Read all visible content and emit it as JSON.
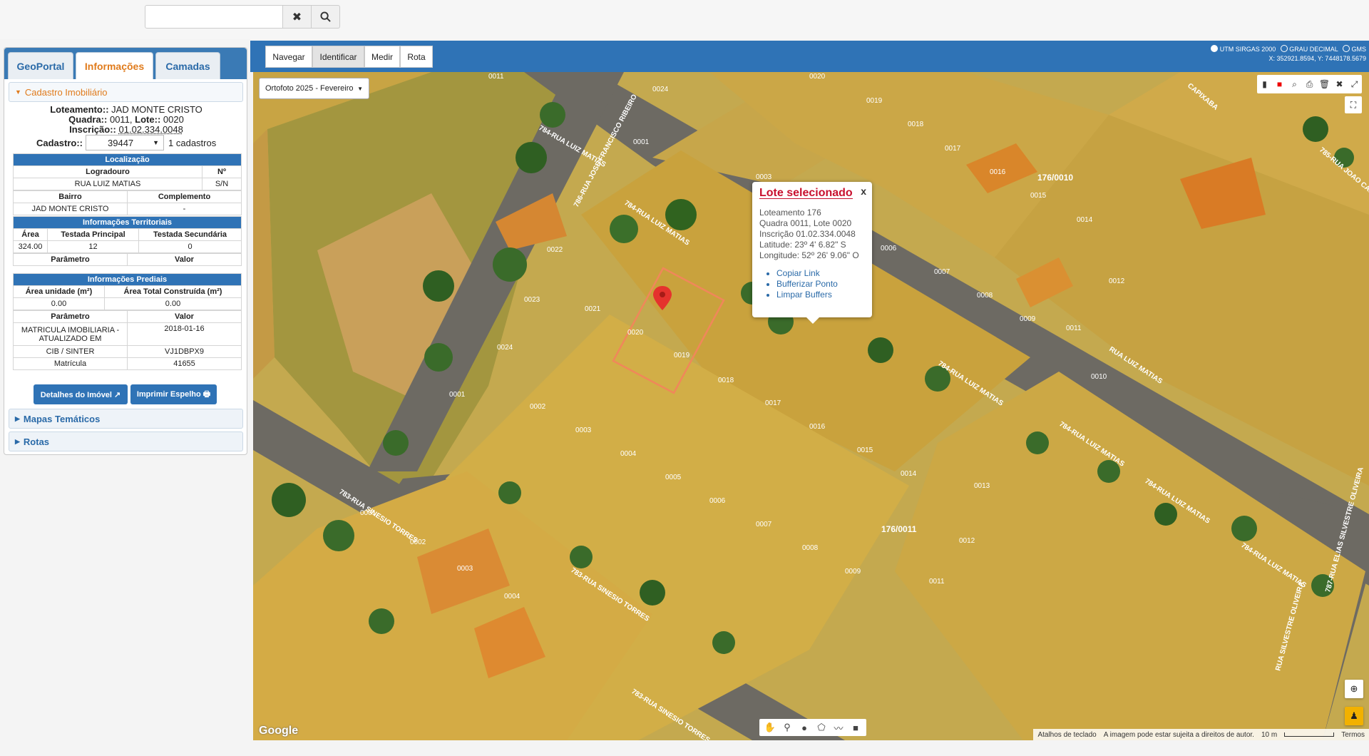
{
  "search": {
    "placeholder": "",
    "clear_icon": "✖",
    "search_icon": "🔍"
  },
  "tabs": [
    {
      "label": "GeoPortal"
    },
    {
      "label": "Informações"
    },
    {
      "label": "Camadas"
    }
  ],
  "cadastro": {
    "section_title": "Cadastro Imobiliário",
    "loteamento_label": "Loteamento::",
    "loteamento_value": "JAD MONTE CRISTO",
    "quadra_label": "Quadra::",
    "quadra_value": "0011,",
    "lote_label": "Lote::",
    "lote_value": "0020",
    "inscricao_label": "Inscrição::",
    "inscricao_value": "01.02.334.0048",
    "cadastro_label": "Cadastro::",
    "cadastro_value": "39447",
    "cadastros_count": "1 cadastros"
  },
  "localizacao": {
    "title": "Localização",
    "headers": [
      "Logradouro",
      "Nº"
    ],
    "row1": [
      "RUA LUIZ MATIAS",
      "S/N"
    ],
    "headers2": [
      "Bairro",
      "Complemento"
    ],
    "row2": [
      "JAD MONTE CRISTO",
      "-"
    ]
  },
  "territoriais": {
    "title": "Informações Territoriais",
    "headers": [
      "Área",
      "Testada Principal",
      "Testada Secundária"
    ],
    "row": [
      "324.00",
      "12",
      "0"
    ],
    "param_headers": [
      "Parâmetro",
      "Valor"
    ]
  },
  "prediais": {
    "title": "Informações Prediais",
    "headers": [
      "Área unidade (m²)",
      "Área Total Construída (m²)"
    ],
    "row": [
      "0.00",
      "0.00"
    ],
    "param_headers": [
      "Parâmetro",
      "Valor"
    ],
    "params": [
      {
        "name": "MATRICULA IMOBILIARIA - ATUALIZADO EM",
        "value": "2018-01-16"
      },
      {
        "name": "CIB / SINTER",
        "value": "VJ1DBPX9"
      },
      {
        "name": "Matrícula",
        "value": "41655"
      }
    ]
  },
  "buttons": {
    "detalhes": "Detalhes do Imóvel ↗",
    "imprimir": "Imprimir Espelho 🖶"
  },
  "sections": {
    "mapas": "Mapas Temáticos",
    "rotas": "Rotas"
  },
  "map_tools": [
    {
      "label": "Navegar"
    },
    {
      "label": "Identificar"
    },
    {
      "label": "Medir"
    },
    {
      "label": "Rota"
    }
  ],
  "coords": {
    "opt1": "UTM SIRGAS 2000",
    "opt2": "GRAU DECIMAL",
    "opt3": "GMS",
    "readout": "X: 352921.8594, Y: 7448178.5679"
  },
  "layer_select": "Ortofoto 2025 - Fevereiro",
  "popup": {
    "title": "Lote selecionado",
    "close": "x",
    "line1": "Loteamento 176",
    "line2": "Quadra 0011, Lote 0020",
    "line3": "Inscrição 01.02.334.0048",
    "line4": "Latitude: 23º 4' 6.82\" S",
    "line5": "Longitude: 52º 26' 9.06\" O",
    "links": [
      "Copiar Link",
      "Bufferizar Ponto",
      "Limpar Buffers"
    ]
  },
  "map_labels": {
    "streets": [
      "784-RUA LUIZ MATIAS",
      "784-RUA LUIZ MATIAS",
      "784-RUA LUIZ MATIAS",
      "784-RUA LUIZ MATIAS",
      "784-RUA LUIZ MATIAS",
      "783-RUA SINESIO TORRES",
      "783-RUA SINESIO TORRES",
      "783-RUA SINESIO TORRES",
      "786-RUA JOSE FRANCISCO RIBEIRO",
      "785-RUA JOAO CAPIXABA",
      "784-RUA LUIZ MATIAS",
      "787-RUA ELIAS SILVESTRE OLIVEIRA",
      "RUA SILVESTRE OLIVEIRA",
      "RUA LUIZ MATIAS",
      "CAPIXABA"
    ],
    "blocks": [
      "176/0010",
      "176/0011"
    ],
    "lots": [
      "0011",
      "0024",
      "0020",
      "0019",
      "0018",
      "0017",
      "0016",
      "0015",
      "0014",
      "0001",
      "0003",
      "0004",
      "0005",
      "0006",
      "0007",
      "0008",
      "0009",
      "0011",
      "0012",
      "0010",
      "0022",
      "0021",
      "0023",
      "0020",
      "0019",
      "0024",
      "0018",
      "0017",
      "0016",
      "0015",
      "0014",
      "0013",
      "0012",
      "0001",
      "0002",
      "0003",
      "0004",
      "0005",
      "0006",
      "0007",
      "0008",
      "0009",
      "0011",
      "0001",
      "0002",
      "0003",
      "0004"
    ]
  },
  "attribution": {
    "shortcuts": "Atalhos de teclado",
    "notice": "A imagem pode estar sujeita a direitos de autor.",
    "scale": "10 m",
    "terms": "Termos"
  },
  "google_logo": "Google"
}
